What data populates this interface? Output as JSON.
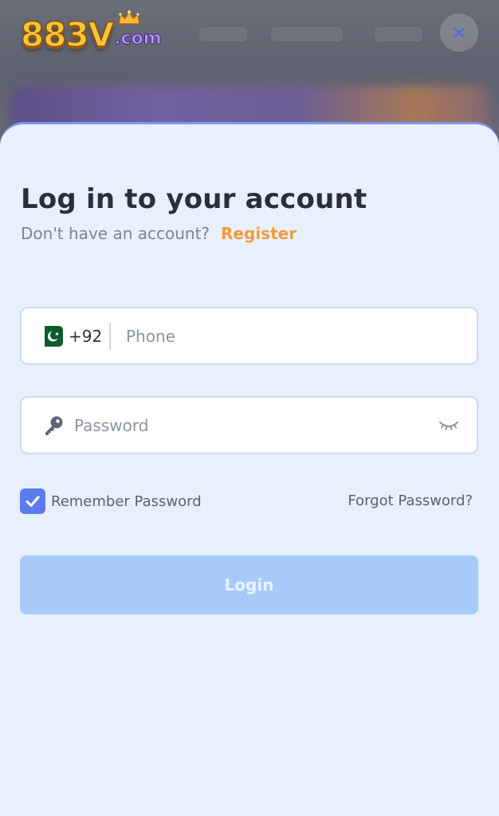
{
  "header": {
    "logo": {
      "main_text": "883V",
      "suffix_text": ".com",
      "crown_icon": "crown-icon"
    },
    "close_icon": "close-icon"
  },
  "login": {
    "title": "Log in to your account",
    "subtitle": "Don't have an account?",
    "register_label": "Register",
    "phone": {
      "country_flag": "pakistan-flag-icon",
      "dial_code": "+92",
      "placeholder": "Phone",
      "value": ""
    },
    "password": {
      "leading_icon": "key-icon",
      "trailing_icon": "eye-closed-icon",
      "placeholder": "Password",
      "value": ""
    },
    "remember": {
      "label": "Remember Password",
      "checked": true
    },
    "forgot_label": "Forgot Password?",
    "submit_label": "Login"
  },
  "colors": {
    "accent": "#5b7cf0",
    "register_link": "#f39a3b",
    "login_button": "#a6cbfb",
    "sheet_background": "#e8f0fc",
    "title_text": "#2b2f3d"
  }
}
